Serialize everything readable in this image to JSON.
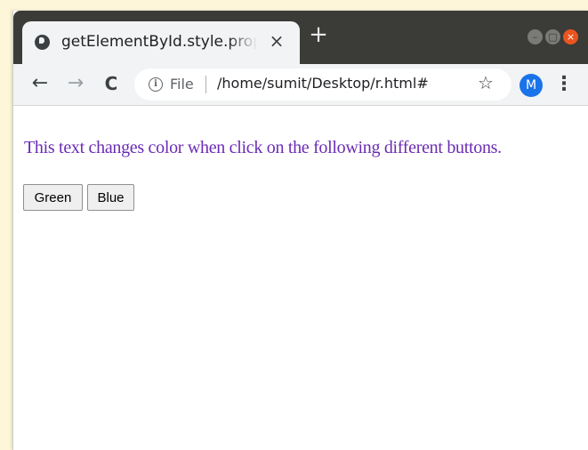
{
  "browser": {
    "tab_title": "getElementById.style.property",
    "tab_close": "×",
    "new_tab": "+",
    "nav": {
      "back": "←",
      "forward": "→",
      "reload": "C"
    },
    "address": {
      "scheme_label": "File",
      "url": "/home/sumit/Desktop/r.html#"
    },
    "profile_initial": "M",
    "window_controls": {
      "minimize": "–",
      "maximize": "□",
      "close": "×"
    }
  },
  "page": {
    "text": "This text changes color when click on the following different buttons.",
    "text_color": "#6a2cb3",
    "buttons": [
      {
        "label": "Green"
      },
      {
        "label": "Blue"
      }
    ]
  },
  "colors": {
    "titlebar": "#3b3b38",
    "toolbar": "#f1f3f4",
    "close_button": "#e95420",
    "avatar": "#1a73e8"
  }
}
